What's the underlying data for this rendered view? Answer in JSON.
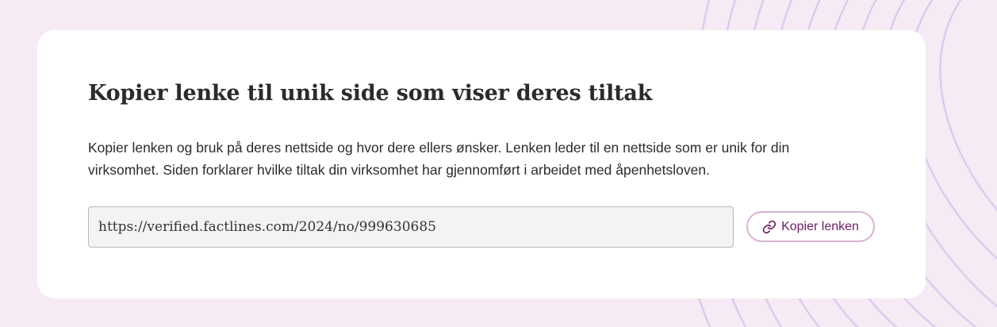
{
  "card": {
    "title": "Kopier lenke til unik side som viser deres tiltak",
    "description": "Kopier lenken og bruk på deres nettside og hvor dere ellers ønsker. Lenken leder til en nettside som er unik for din virksomhet. Siden forklarer hvilke tiltak din virksomhet har gjennomført i arbeidet med åpenhetsloven.",
    "link_value": "https://verified.factlines.com/2024/no/999630685",
    "copy_button_label": "Kopier lenken",
    "copy_button_icon": "link-icon"
  },
  "colors": {
    "page_background": "#f6eaf4",
    "card_background": "#ffffff",
    "accent": "#6e1d63",
    "button_border": "#d7b3d3",
    "decoration_lines": "#dccbee"
  }
}
